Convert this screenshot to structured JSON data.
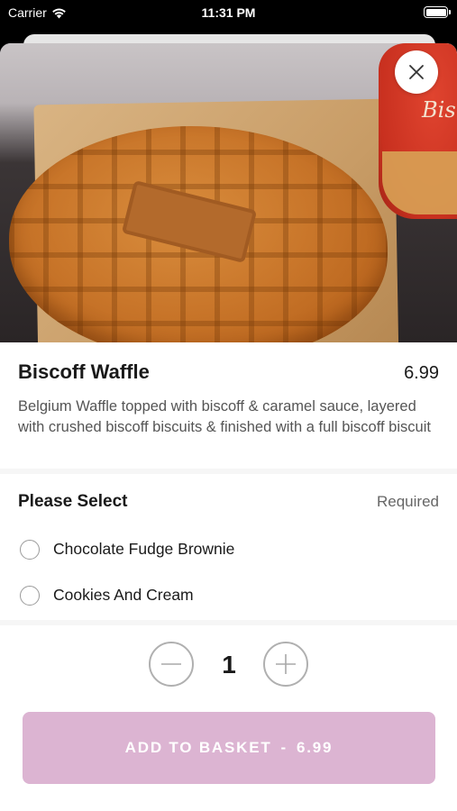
{
  "status_bar": {
    "carrier": "Carrier",
    "time": "11:31 PM"
  },
  "hero": {
    "jar_text": "Bis"
  },
  "product": {
    "name": "Biscoff Waffle",
    "price": "6.99",
    "description": "Belgium Waffle topped with biscoff & caramel sauce, layered with crushed biscoff biscuits & finished with a full biscoff biscuit"
  },
  "options": {
    "heading": "Please Select",
    "requirement": "Required",
    "items": [
      {
        "label": "Chocolate Fudge Brownie",
        "selected": false
      },
      {
        "label": "Cookies And Cream",
        "selected": false
      }
    ]
  },
  "quantity": {
    "value": "1"
  },
  "basket": {
    "label": "ADD TO BASKET",
    "separator": "-",
    "total": "6.99",
    "color": "#dcb4d2"
  },
  "icons": {
    "close": "close-icon",
    "minus": "minus-icon",
    "plus": "plus-icon",
    "wifi": "wifi-icon",
    "battery": "battery-icon"
  }
}
